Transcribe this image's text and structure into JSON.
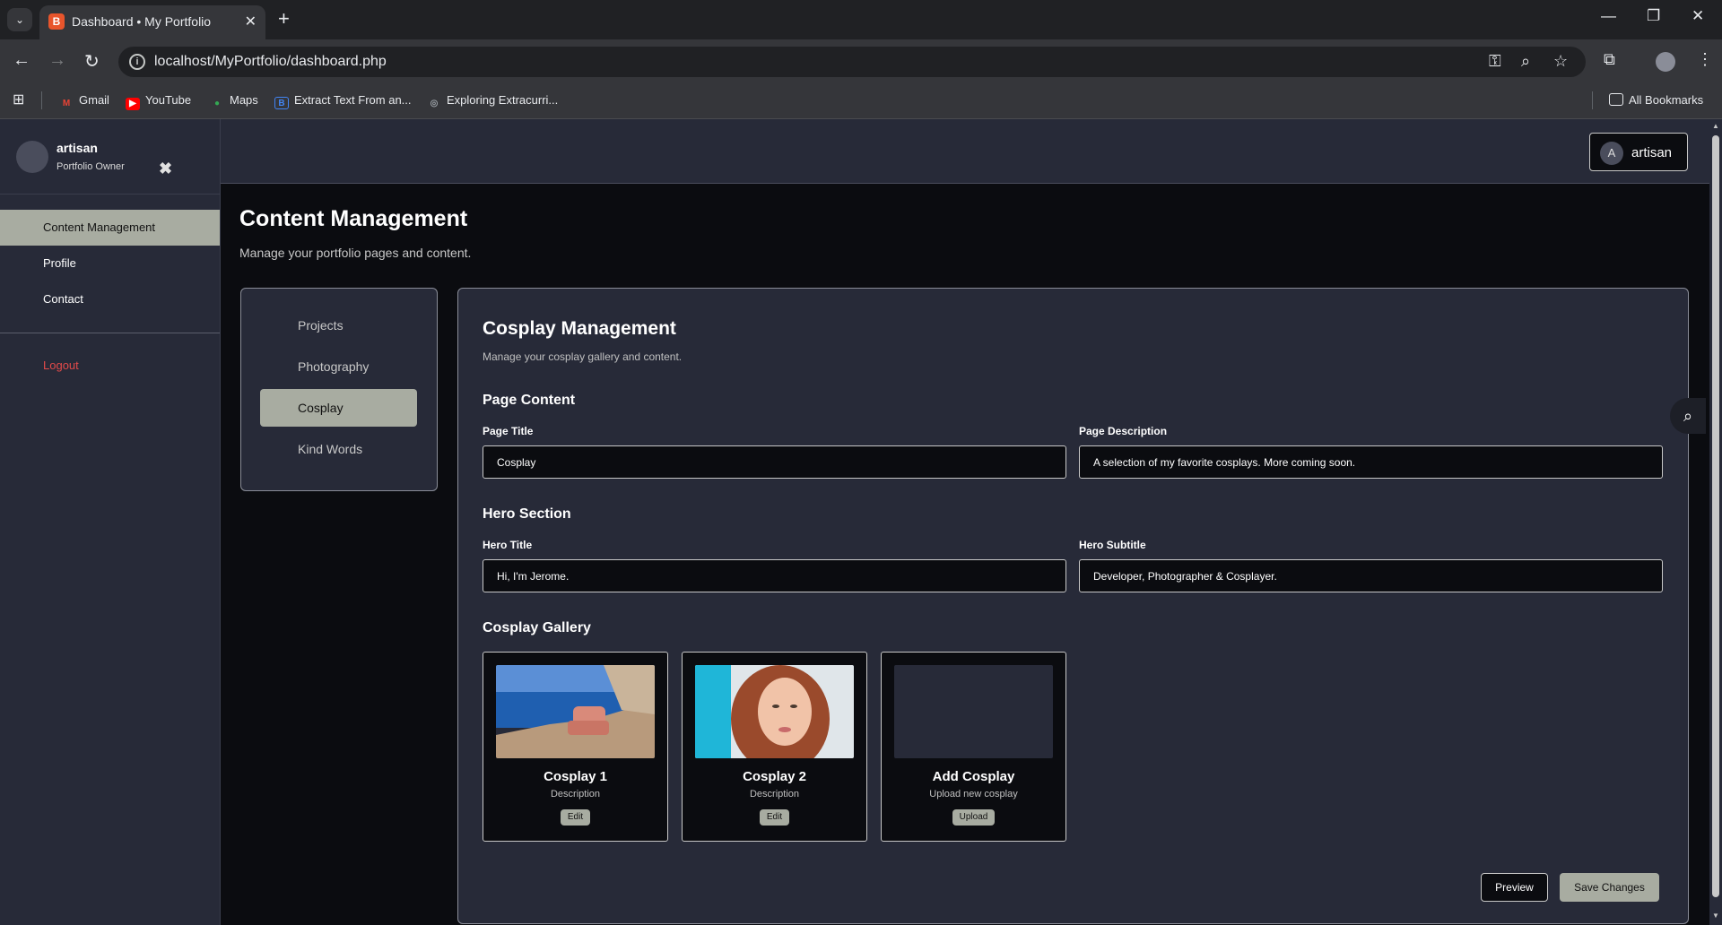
{
  "browser": {
    "tab_title": "Dashboard • My Portfolio",
    "favicon_letter": "B",
    "url": "localhost/MyPortfolio/dashboard.php",
    "bookmarks": [
      {
        "label": "Gmail",
        "icon": "gmail-icon",
        "color": "#ea4335"
      },
      {
        "label": "YouTube",
        "icon": "youtube-icon",
        "color": "#ff0000"
      },
      {
        "label": "Maps",
        "icon": "maps-icon",
        "color": "#34a853"
      },
      {
        "label": "Extract Text From an...",
        "icon": "extract-text-icon",
        "color": "#4285f4"
      },
      {
        "label": "Exploring Extracurri...",
        "icon": "globe-icon",
        "color": "#9aa0a6"
      }
    ],
    "all_bookmarks": "All Bookmarks"
  },
  "sidebar": {
    "user_name": "artisan",
    "user_role": "Portfolio Owner",
    "items": [
      {
        "label": "Content Management",
        "active": true
      },
      {
        "label": "Profile",
        "active": false
      },
      {
        "label": "Contact",
        "active": false
      }
    ],
    "logout": "Logout"
  },
  "topbar": {
    "avatar_letter": "A",
    "user_name": "artisan"
  },
  "page": {
    "title": "Content Management",
    "subtitle": "Manage your portfolio pages and content."
  },
  "subnav": [
    {
      "label": "Projects",
      "active": false
    },
    {
      "label": "Photography",
      "active": false
    },
    {
      "label": "Cosplay",
      "active": true
    },
    {
      "label": "Kind Words",
      "active": false
    }
  ],
  "panel": {
    "title": "Cosplay Management",
    "subtitle": "Manage your cosplay gallery and content.",
    "page_content": {
      "heading": "Page Content",
      "page_title_label": "Page Title",
      "page_title_value": "Cosplay",
      "page_desc_label": "Page Description",
      "page_desc_value": "A selection of my favorite cosplays. More coming soon."
    },
    "hero": {
      "heading": "Hero Section",
      "title_label": "Hero Title",
      "title_value": "Hi, I'm Jerome.",
      "subtitle_label": "Hero Subtitle",
      "subtitle_value": "Developer, Photographer & Cosplayer."
    },
    "gallery": {
      "heading": "Cosplay Gallery",
      "cards": [
        {
          "title": "Cosplay 1",
          "desc": "Description",
          "button": "Edit"
        },
        {
          "title": "Cosplay 2",
          "desc": "Description",
          "button": "Edit"
        },
        {
          "title": "Add Cosplay",
          "desc": "Upload new cosplay",
          "button": "Upload"
        }
      ]
    },
    "preview_label": "Preview",
    "save_label": "Save Changes"
  },
  "colors": {
    "accent": "#a8aca1",
    "logout": "#e24a4a",
    "panel_bg": "#272a38",
    "page_bg": "#0b0c10"
  }
}
